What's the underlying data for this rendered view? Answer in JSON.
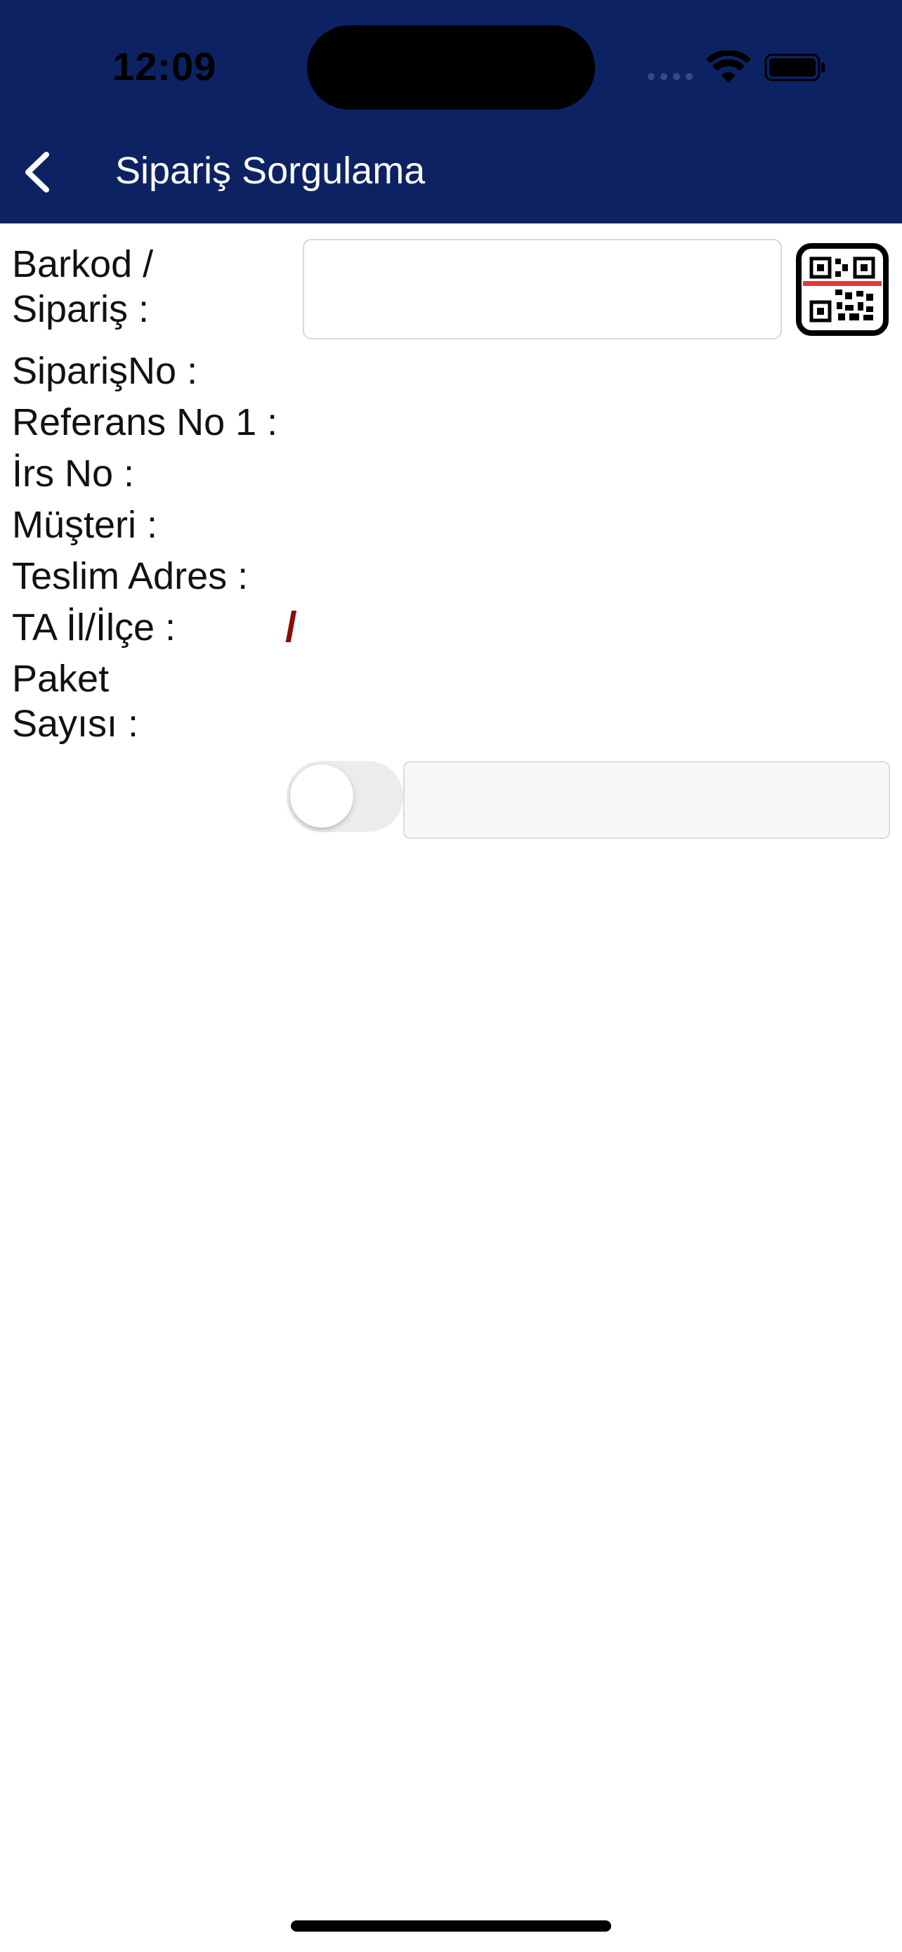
{
  "status_bar": {
    "time": "12:09",
    "icons": [
      "signal-icon",
      "wifi-icon",
      "battery-icon"
    ]
  },
  "nav": {
    "back_icon": "chevron-left-icon",
    "title": "Sipariş Sorgulama"
  },
  "form": {
    "barcode_label_line1": "Barkod /",
    "barcode_label_line2": "Sipariş :",
    "barcode_value": "",
    "qr_icon": "qr-code-scan-icon",
    "order_no_label": "SiparişNo :",
    "reference_no_label": "Referans No 1 :",
    "waybill_no_label": "İrs No :",
    "customer_label": "Müşteri :",
    "delivery_address_label": "Teslim Adres :",
    "city_district_label": "TA İl/İlçe :",
    "city_district_value": "/",
    "package_count_label_line1": "Paket",
    "package_count_label_line2": "Sayısı :",
    "toggle_on": false,
    "package_count_value": ""
  },
  "colors": {
    "header_bg": "#0d2263",
    "slash_color": "#8b0a0a",
    "qr_scan_line": "#e53935"
  }
}
